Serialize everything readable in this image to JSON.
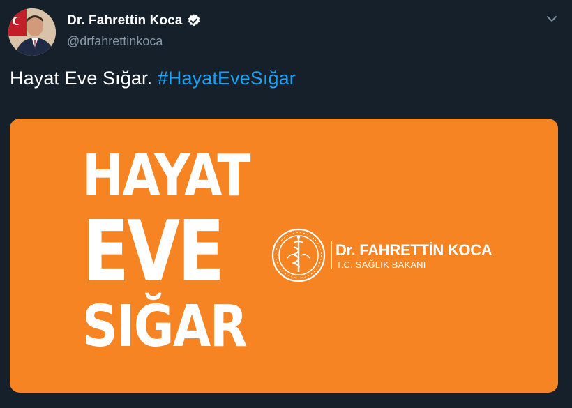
{
  "author": {
    "display_name": "Dr. Fahrettin Koca",
    "handle": "@drfahrettinkoca",
    "verified": true
  },
  "icons": {
    "verified": "verified-badge-icon",
    "menu": "chevron-down-icon"
  },
  "tweet": {
    "text": "Hayat Eve Sığar. ",
    "hashtag": "#HayatEveSığar"
  },
  "media": {
    "slogan_line1": "HAYAT",
    "slogan_line2": "EVE",
    "slogan_line3": "SIĞAR",
    "signature_name": "Dr. FAHRETTİN KOCA",
    "signature_title": "T.C. SAĞLIK BAKANI"
  },
  "colors": {
    "background": "#15202b",
    "hashtag": "#1da1f2",
    "handle": "#8899a6",
    "media_bg": "#f78422"
  }
}
